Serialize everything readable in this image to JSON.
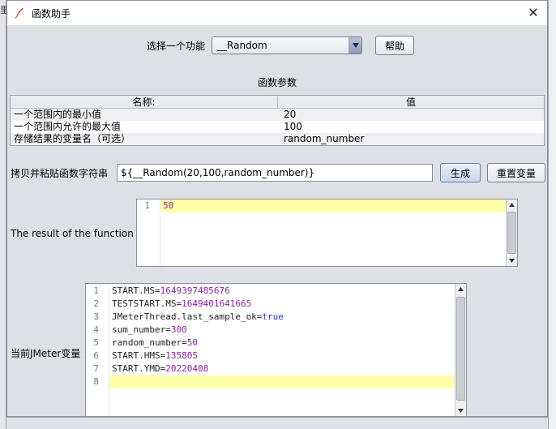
{
  "window": {
    "title": "函数助手",
    "close_glyph": "✕"
  },
  "background": {
    "left_glyph": "里"
  },
  "function_select": {
    "label": "选择一个功能",
    "value": "__Random",
    "help_label": "帮助"
  },
  "params": {
    "section_title": "函数参数",
    "headers": {
      "name": "名称:",
      "value": "值"
    },
    "rows": [
      {
        "name": "一个范围内的最小值",
        "value": "20"
      },
      {
        "name": "一个范围内允许的最大值",
        "value": "100"
      },
      {
        "name": "存储结果的变量名（可选）",
        "value": "random_number"
      }
    ]
  },
  "copy": {
    "label": "拷贝并粘贴函数字符串",
    "value": "${__Random(20,100,random_number)}",
    "generate_label": "生成",
    "reset_label": "重置变量"
  },
  "result": {
    "label": "The result of the function is",
    "lines": [
      {
        "num": "1",
        "value": "50"
      }
    ]
  },
  "variables": {
    "label": "当前JMeter变量",
    "lines": [
      {
        "num": "1",
        "key": "START.MS=",
        "value": "1649397485676"
      },
      {
        "num": "2",
        "key": "TESTSTART.MS=",
        "value": "1649401641665"
      },
      {
        "num": "3",
        "key": "JMeterThread.last_sample_ok=",
        "value": "true"
      },
      {
        "num": "4",
        "key": "sum_number=",
        "value": "300"
      },
      {
        "num": "5",
        "key": "random_number=",
        "value": "50"
      },
      {
        "num": "6",
        "key": "START.HMS=",
        "value": "135805"
      },
      {
        "num": "7",
        "key": "START.YMD=",
        "value": "20220408"
      },
      {
        "num": "8",
        "key": "",
        "value": ""
      }
    ]
  },
  "colors": {
    "dialog_bg": "#dde0e5",
    "active_line": "#ffffaa",
    "value_purple": "#8b1fa3",
    "keyword_blue": "#2d35b8"
  }
}
